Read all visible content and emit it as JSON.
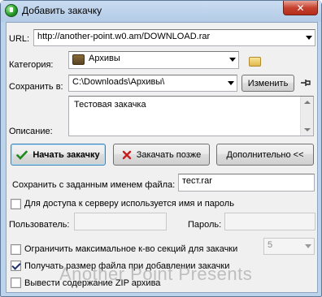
{
  "window": {
    "title": "Добавить закачку",
    "close_symbol": "✕",
    "icon": "green-globe-arrow-icon"
  },
  "url": {
    "label": "URL:",
    "value": "http://another-point.w0.am/DOWNLOAD.rar"
  },
  "category": {
    "label": "Категория:",
    "value": "Архивы"
  },
  "save_to": {
    "label": "Сохранить в:",
    "value": "C:\\Downloads\\Архивы\\",
    "change_button": "Изменить"
  },
  "description": {
    "label": "Описание:",
    "value": "Тестовая закачка"
  },
  "buttons": {
    "start": "Начать закачку",
    "later": "Закачать позже",
    "more": "Дополнительно <<"
  },
  "save_as": {
    "label": "Сохранить с заданным именем файла:",
    "value": "тест.rar"
  },
  "auth": {
    "checkbox_label": "Для доступа к серверу используется имя и пароль",
    "checked": false,
    "user_label": "Пользователь:",
    "user_value": "",
    "password_label": "Пароль:",
    "password_value": ""
  },
  "options": {
    "limit_sections": {
      "label": "Ограничить максимальное к-во секций для закачки",
      "checked": false,
      "value": "5"
    },
    "get_size": {
      "label": "Получать размер файла при добавлении закачки",
      "checked": true
    },
    "show_zip": {
      "label": "Вывести содержание ZIP архива",
      "checked": false
    }
  },
  "watermark": "Another Point Presents",
  "colors": {
    "titlebar": "#bcd3ec",
    "close_button": "#c7412f",
    "dialog_bg": "#f0f0f0"
  }
}
